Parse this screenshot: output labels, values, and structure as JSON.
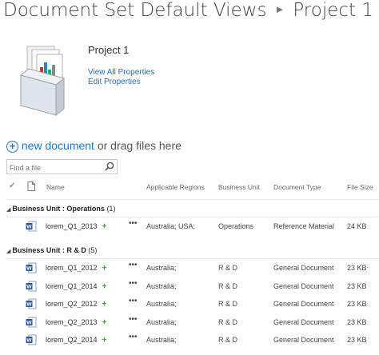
{
  "breadcrumb": {
    "library": "Document Set Default Views",
    "current": "Project 1"
  },
  "docset": {
    "title": "Project 1",
    "view_all_properties": "View All Properties",
    "edit_properties": "Edit Properties"
  },
  "toolbar": {
    "new_document": "new document",
    "or_drag": "or drag files here"
  },
  "search": {
    "placeholder": "Find a file"
  },
  "columns": {
    "name": "Name",
    "regions": "Applicable Regions",
    "business_unit": "Business Unit",
    "doc_type": "Document Type",
    "file_size": "File Size"
  },
  "groups": [
    {
      "label_prefix": "Business Unit : ",
      "label_value": "Operations",
      "count": "(1)",
      "rows": [
        {
          "name": "lorem_Q1_2013",
          "regions": "Australia; USA;",
          "business_unit": "Operations",
          "doc_type": "Reference Material",
          "size": "24 KB"
        }
      ]
    },
    {
      "label_prefix": "Business Unit : ",
      "label_value": "R & D",
      "count": "(5)",
      "rows": [
        {
          "name": "lorem_Q1_2012",
          "regions": "Australia;",
          "business_unit": "R & D",
          "doc_type": "General Document",
          "size": "23 KB"
        },
        {
          "name": "lorem_Q1_2014",
          "regions": "Australia;",
          "business_unit": "R & D",
          "doc_type": "General Document",
          "size": "23 KB"
        },
        {
          "name": "lorem_Q2_2012",
          "regions": "Australia;",
          "business_unit": "R & D",
          "doc_type": "General Document",
          "size": "23 KB"
        },
        {
          "name": "lorem_Q2_2013",
          "regions": "Australia;",
          "business_unit": "R & D",
          "doc_type": "General Document",
          "size": "23 KB"
        },
        {
          "name": "lorem_Q2_2014",
          "regions": "Australia;",
          "business_unit": "R & D",
          "doc_type": "General Document",
          "size": "23 KB"
        }
      ]
    }
  ],
  "more_label": "•••",
  "colors": {
    "link": "#1d75c9",
    "new_badge": "#3aa53a",
    "word_blue": "#2b579a"
  }
}
